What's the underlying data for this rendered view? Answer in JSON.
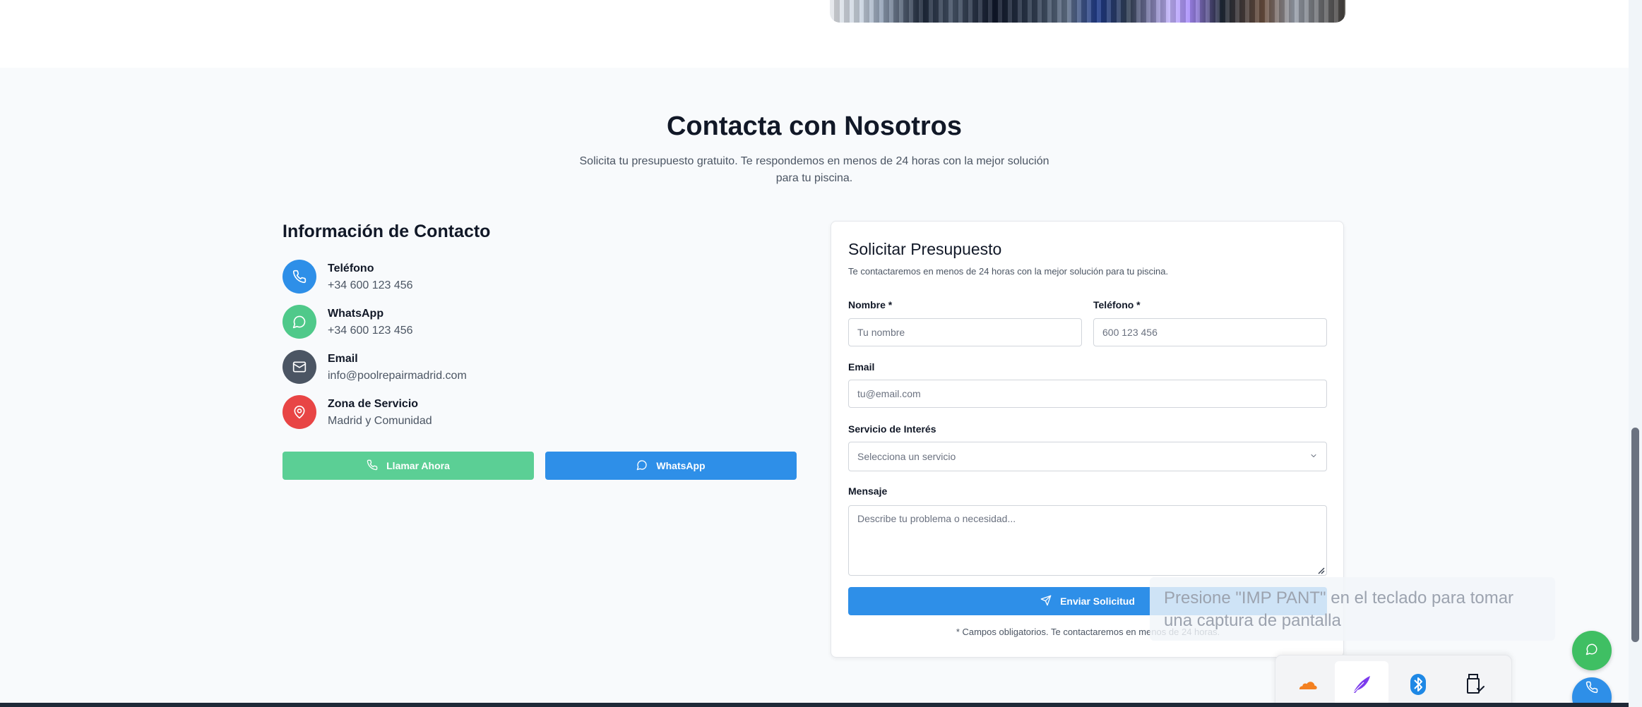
{
  "contact_section": {
    "title": "Contacta con Nosotros",
    "subtitle": "Solicita tu presupuesto gratuito. Te respondemos en menos de 24 horas con la mejor solución para tu piscina."
  },
  "contact_info": {
    "title": "Información de Contacto",
    "items": [
      {
        "label": "Teléfono",
        "value": "+34 600 123 456",
        "icon": "phone-icon",
        "color": "#2e8fe8"
      },
      {
        "label": "WhatsApp",
        "value": "+34 600 123 456",
        "icon": "chat-icon",
        "color": "#4fc98a"
      },
      {
        "label": "Email",
        "value": "info@poolrepairmadrid.com",
        "icon": "mail-icon",
        "color": "#4b5563"
      },
      {
        "label": "Zona de Servicio",
        "value": "Madrid y Comunidad",
        "icon": "map-pin-icon",
        "color": "#e84545"
      }
    ],
    "call_button": "Llamar Ahora",
    "whatsapp_button": "WhatsApp"
  },
  "form": {
    "title": "Solicitar Presupuesto",
    "subtitle": "Te contactaremos en menos de 24 horas con la mejor solución para tu piscina.",
    "name_label": "Nombre *",
    "name_placeholder": "Tu nombre",
    "phone_label": "Teléfono *",
    "phone_placeholder": "600 123 456",
    "email_label": "Email",
    "email_placeholder": "tu@email.com",
    "service_label": "Servicio de Interés",
    "service_selected": "Selecciona un servicio",
    "message_label": "Mensaje",
    "message_placeholder": "Describe tu problema o necesidad...",
    "submit_label": "Enviar Solicitud",
    "footnote": "* Campos obligatorios. Te contactaremos en menos de 24 horas."
  },
  "toast": {
    "text": "Presione \"IMP PANT\" en el teclado para tomar una captura de pantalla"
  },
  "tray": {
    "icons": [
      "cloudflare-icon",
      "quill-icon",
      "bluetooth-icon",
      "usb-eject-icon"
    ]
  },
  "colors": {
    "primary": "#2e8fe8",
    "green": "#5bcf95",
    "whatsapp_float": "#3fbf63",
    "red": "#e84545"
  }
}
